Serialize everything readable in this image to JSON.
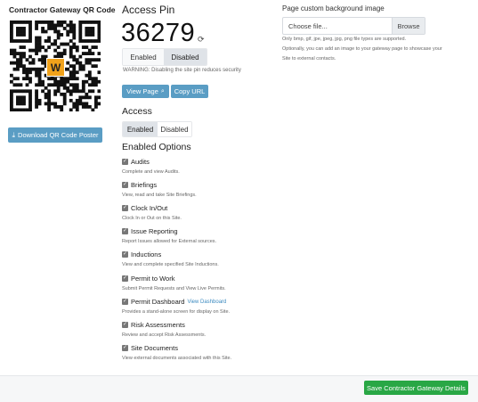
{
  "qr": {
    "title": "Contractor Gateway QR Code",
    "logo_letter": "W",
    "logo_color": "#f0a21b",
    "download_label": "Download QR Code Poster"
  },
  "access_pin": {
    "heading": "Access Pin",
    "value": "36279",
    "enabled_label": "Enabled",
    "disabled_label": "Disabled",
    "selected": "Disabled",
    "warning": "WARNING: Disabling the site pin reduces security"
  },
  "buttons": {
    "view_page": "View Page",
    "copy_url": "Copy URL"
  },
  "access": {
    "heading": "Access",
    "enabled_label": "Enabled",
    "disabled_label": "Disabled",
    "selected": "Enabled"
  },
  "enabled_options": {
    "heading": "Enabled Options",
    "items": [
      {
        "label": "Audits",
        "desc": "Complete and view Audits.",
        "checked": true
      },
      {
        "label": "Briefings",
        "desc": "View, read and take Site Briefings.",
        "checked": true
      },
      {
        "label": "Clock In/Out",
        "desc": "Clock In or Out on this Site.",
        "checked": true
      },
      {
        "label": "Issue Reporting",
        "desc": "Report Issues allowed for External sources.",
        "checked": true
      },
      {
        "label": "Inductions",
        "desc": "View and complete specified Site Inductions.",
        "checked": true
      },
      {
        "label": "Permit to Work",
        "desc": "Submit Permit Requests and View Live Permits.",
        "checked": true
      },
      {
        "label": "Permit Dashboard",
        "link": "View Dashboard",
        "desc": "Provides a stand-alone screen for display on Site.",
        "checked": true
      },
      {
        "label": "Risk Assessments",
        "desc": "Review and accept Risk Assessments.",
        "checked": true
      },
      {
        "label": "Site Documents",
        "desc": "View external documents associated with this Site.",
        "checked": true
      }
    ]
  },
  "background": {
    "label": "Page custom background image",
    "placeholder": "Choose file...",
    "browse_label": "Browse",
    "hint1": "Only bmp, gif, jpe, jpeg, jpg, png file types are supported.",
    "hint2": "Optionally, you can add an image to your gateway page to showcase your",
    "hint3": "Site to external contacts."
  },
  "footer": {
    "save_label": "Save Contractor Gateway Details"
  },
  "colors": {
    "primary": "#5a9dc4",
    "success": "#29a745",
    "link": "#3d8bc0"
  }
}
